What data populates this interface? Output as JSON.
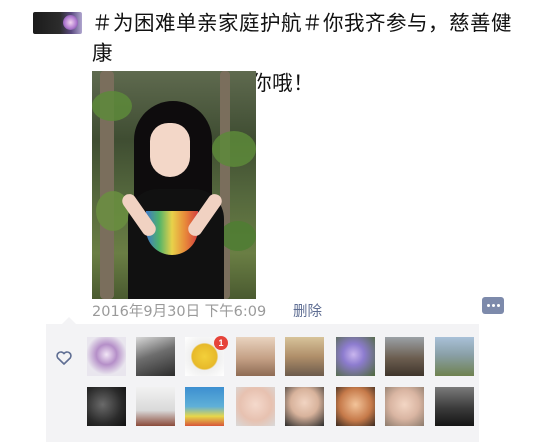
{
  "post": {
    "text": "＃为困难单亲家庭护航＃你我齐参与，慈善健康\n行。11月27日等你哦！",
    "timestamp": "2016年9月30日  下午6:09",
    "delete_label": "删除"
  },
  "likes": {
    "badge_count": "1"
  },
  "colors": {
    "link": "#5f6e93",
    "meta": "#9a9a9a",
    "panel_bg": "#f3f3f5",
    "comment_button": "#7d8aab",
    "badge": "#e6433a"
  }
}
